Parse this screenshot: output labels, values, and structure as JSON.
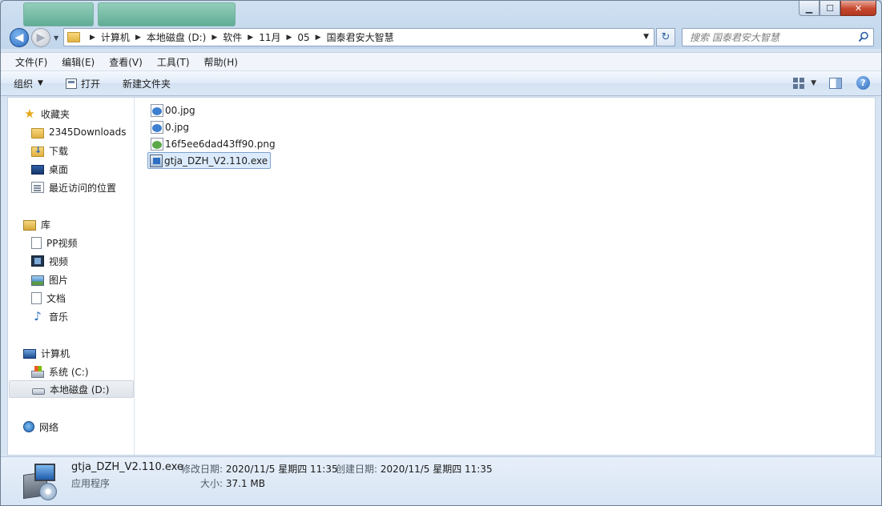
{
  "window": {
    "controls": {
      "minimize": "▁",
      "maximize": "☐",
      "close": "✕"
    }
  },
  "address": {
    "path": [
      "计算机",
      "本地磁盘 (D:)",
      "软件",
      "11月",
      "05",
      "国泰君安大智慧"
    ]
  },
  "search": {
    "placeholder": "搜索 国泰君安大智慧"
  },
  "menu": [
    "文件(F)",
    "编辑(E)",
    "查看(V)",
    "工具(T)",
    "帮助(H)"
  ],
  "toolbar": {
    "organize": "组织",
    "open": "打开",
    "new_folder": "新建文件夹"
  },
  "nav": {
    "favorites": {
      "title": "收藏夹",
      "items": [
        "2345Downloads",
        "下载",
        "桌面",
        "最近访问的位置"
      ]
    },
    "libraries": {
      "title": "库",
      "items": [
        "PP视频",
        "视频",
        "图片",
        "文档",
        "音乐"
      ]
    },
    "computer": {
      "title": "计算机",
      "items": [
        "系统 (C:)",
        "本地磁盘 (D:)"
      ]
    },
    "network": {
      "title": "网络"
    }
  },
  "files": [
    {
      "name": "00.jpg",
      "type": "jpg"
    },
    {
      "name": "0.jpg",
      "type": "jpg"
    },
    {
      "name": "16f5ee6dad43ff90.png",
      "type": "png"
    },
    {
      "name": "gtja_DZH_V2.110.exe",
      "type": "exe",
      "selected": true
    }
  ],
  "details": {
    "name": "gtja_DZH_V2.110.exe",
    "type": "应用程序",
    "modified_label": "修改日期:",
    "modified": "2020/11/5 星期四 11:35",
    "created_label": "创建日期:",
    "created": "2020/11/5 星期四 11:35",
    "size_label": "大小:",
    "size": "37.1 MB"
  }
}
